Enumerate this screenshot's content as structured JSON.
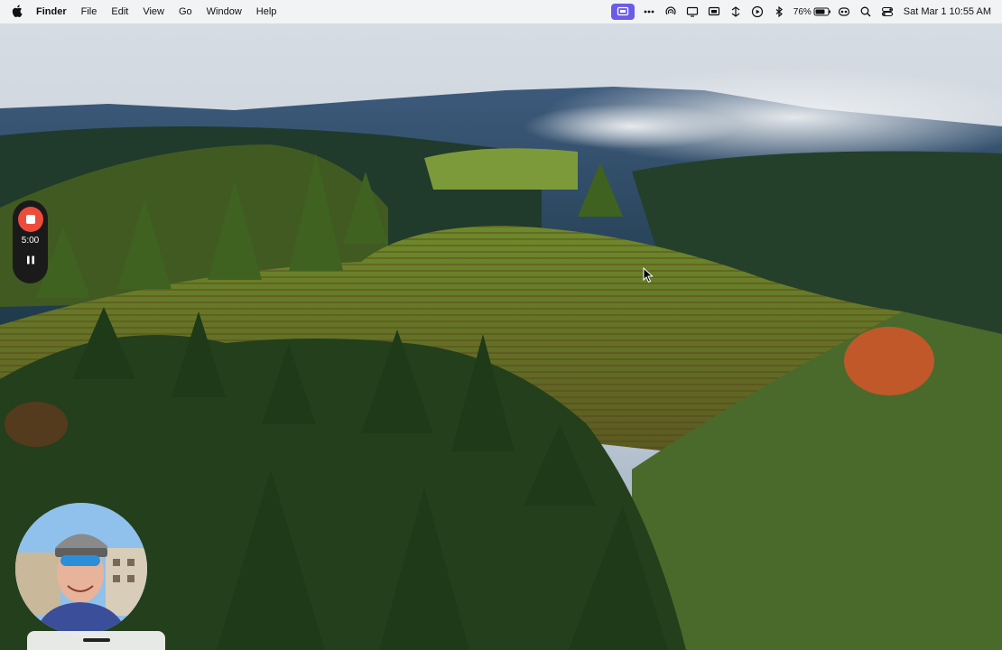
{
  "menubar": {
    "apple_icon": "apple-logo-icon",
    "app_name": "Finder",
    "menus": [
      "File",
      "Edit",
      "View",
      "Go",
      "Window",
      "Help"
    ],
    "status_icons": [
      "screen-recording-icon",
      "more-icon",
      "airdrop-icon",
      "display-icon",
      "screen-mirroring-icon",
      "network-icon",
      "play-icon",
      "bluetooth-icon"
    ],
    "battery_percent": "76%",
    "extra_icons": [
      "wifi-icon",
      "search-icon",
      "control-center-icon"
    ],
    "clock": "Sat Mar 1  10:55 AM"
  },
  "recorder": {
    "stop_icon": "stop-record-icon",
    "time": "5:00",
    "pause_icon": "pause-icon"
  },
  "webcam": {
    "label": "webcam-overlay"
  },
  "colors": {
    "record_red": "#ee4c3a",
    "active_icon_bg": "#6b5ce7"
  }
}
